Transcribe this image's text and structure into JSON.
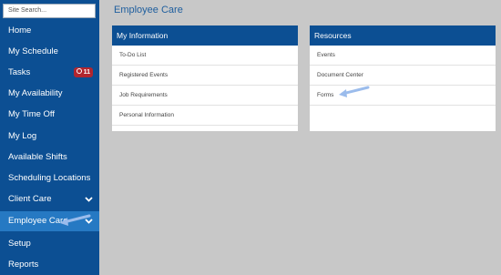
{
  "sidebar": {
    "search_placeholder": "Site Search...",
    "items": [
      {
        "label": "Home"
      },
      {
        "label": "My Schedule"
      },
      {
        "label": "Tasks",
        "badge": "11"
      },
      {
        "label": "My Availability"
      },
      {
        "label": "My Time Off"
      },
      {
        "label": "My Log"
      },
      {
        "label": "Available Shifts"
      },
      {
        "label": "Scheduling Locations"
      },
      {
        "label": "Client Care"
      },
      {
        "label": "Employee Care"
      },
      {
        "label": "Setup"
      },
      {
        "label": "Reports"
      }
    ]
  },
  "main": {
    "title": "Employee Care",
    "panels": [
      {
        "header": "My Information",
        "items": [
          "To-Do List",
          "Registered Events",
          "Job Requirements",
          "Personal Information"
        ]
      },
      {
        "header": "Resources",
        "items": [
          "Events",
          "Document Center",
          "Forms"
        ]
      }
    ]
  },
  "colors": {
    "sidebar": "#0c4f93",
    "active_item": "#2679c3",
    "badge": "#b2262f",
    "background": "#c8c8c8",
    "annotation_arrow": "#9bbcec"
  }
}
